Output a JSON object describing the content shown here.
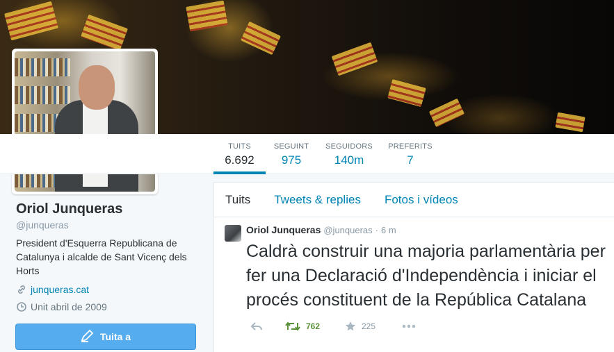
{
  "profile": {
    "name": "Oriol Junqueras",
    "handle": "@junqueras",
    "bio": "President d'Esquerra Republicana de Catalunya i alcalde de Sant Vicenç dels Horts",
    "url": "junqueras.cat",
    "joined": "Unit abril de 2009",
    "tweet_to_label": "Tuita a"
  },
  "stats": [
    {
      "label": "TUITS",
      "value": "6.692"
    },
    {
      "label": "SEGUINT",
      "value": "975"
    },
    {
      "label": "SEGUIDORS",
      "value": "140m"
    },
    {
      "label": "PREFERITS",
      "value": "7"
    }
  ],
  "tabs": [
    {
      "label": "Tuits"
    },
    {
      "label": "Tweets & replies"
    },
    {
      "label": "Fotos i vídeos"
    }
  ],
  "tweet": {
    "name": "Oriol Junqueras",
    "handle": "@junqueras",
    "dot": "·",
    "time": "6 m",
    "text": "Caldrà construir una majoria parlamentària per fer una Declaració d'Independència i iniciar el procés constituent de la República Catalana",
    "retweets": "762",
    "favorites": "225"
  },
  "colors": {
    "link": "#0084b4",
    "button": "#55acee",
    "retweet": "#5c913b"
  },
  "icons": {
    "url": "link-icon",
    "joined": "clock-icon",
    "tweet_to": "compose-icon",
    "reply": "reply-icon",
    "retweet": "retweet-icon",
    "favorite": "star-icon",
    "more": "more-icon"
  }
}
